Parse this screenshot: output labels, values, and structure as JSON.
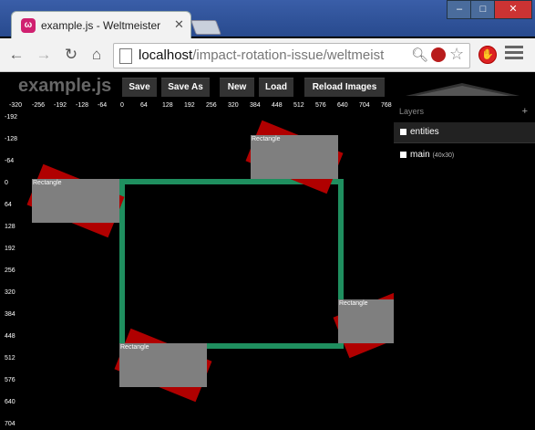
{
  "browser": {
    "tab_title": "example.js - Weltmeister",
    "tab_favicon": "ω",
    "url_host": "localhost",
    "url_path": "/impact-rotation-issue/weltmeist"
  },
  "editor": {
    "title": "example.js",
    "buttons": [
      "Save",
      "Save As",
      "New",
      "Load",
      "Reload Images"
    ],
    "ruler_x": [
      "-320",
      "-256",
      "-192",
      "-128",
      "-64",
      "0",
      "64",
      "128",
      "192",
      "256",
      "320",
      "384",
      "448",
      "512",
      "576",
      "640",
      "704",
      "768"
    ],
    "ruler_y": [
      "-192",
      "-128",
      "-64",
      "0",
      "64",
      "128",
      "192",
      "256",
      "320",
      "384",
      "448",
      "512",
      "576",
      "640",
      "704"
    ],
    "entity_label": "Rectangle",
    "layers_title": "Layers",
    "layers_add": "+",
    "layers": [
      {
        "name": "entities",
        "dims": ""
      },
      {
        "name": "main",
        "dims": "(40x30)"
      }
    ]
  },
  "colors": {
    "entity_red": "#b00000",
    "entity_grey": "#7f7f7f",
    "collision_box": "#1f8f5f"
  },
  "icons": {
    "back": "back-arrow-icon",
    "forward": "forward-arrow-icon",
    "reload": "reload-icon",
    "home": "home-icon",
    "zoom": "zoom-icon",
    "star": "bookmark-star-icon",
    "adblock": "adblock-icon",
    "menu": "menu-icon"
  }
}
